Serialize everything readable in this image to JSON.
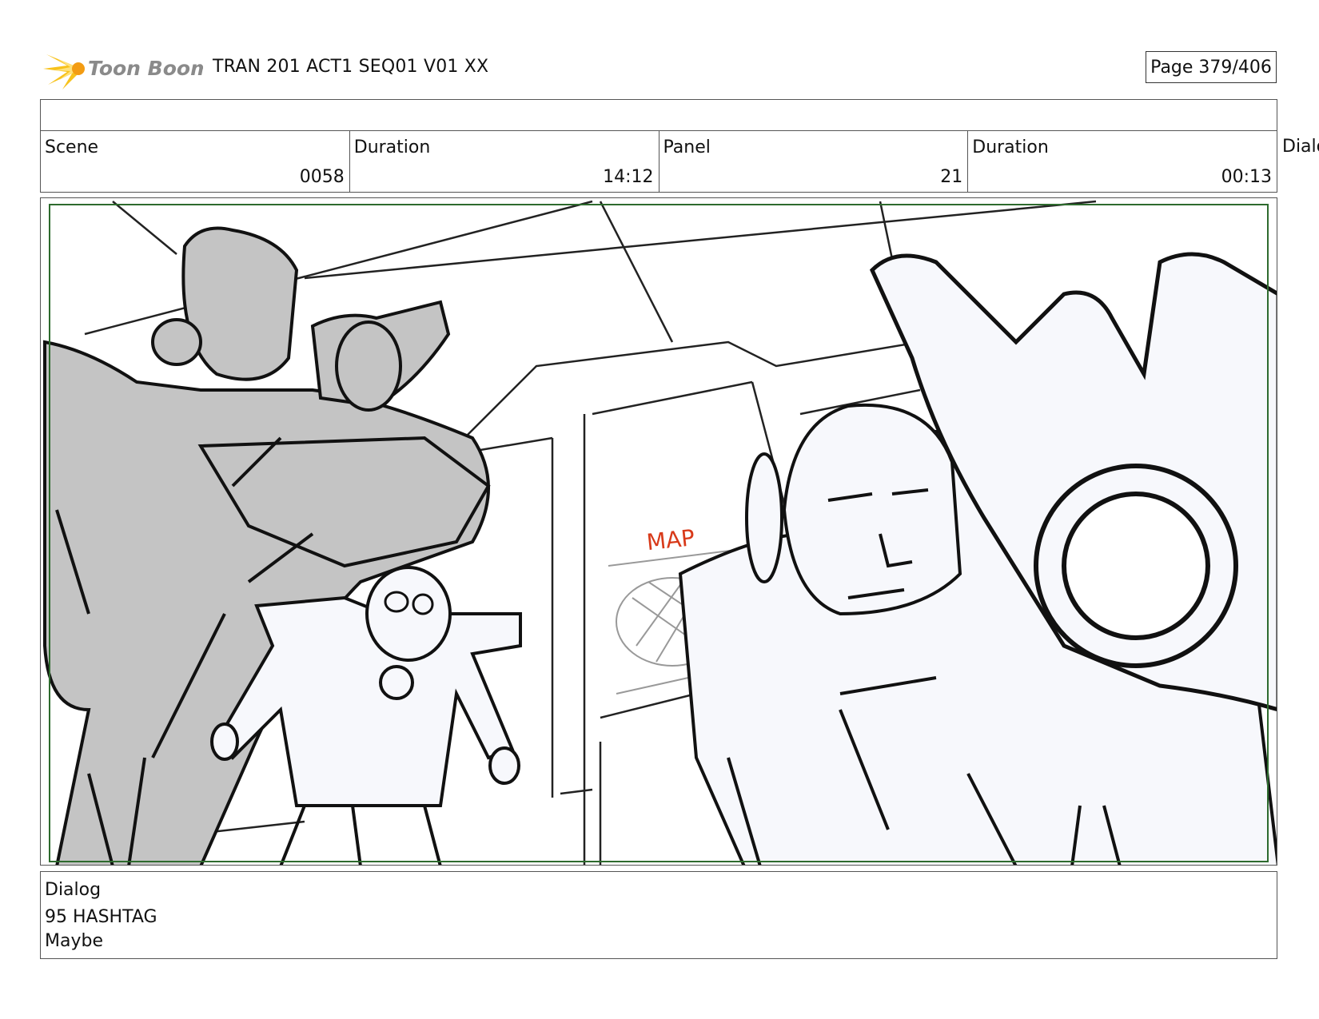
{
  "header": {
    "logo_text": "Toon Boom",
    "title": "TRAN 201 ACT1 SEQ01 V01 XX",
    "page": "Page 379/406"
  },
  "info": {
    "scene_label": "Scene",
    "scene_value": "0058",
    "duration_label": "Duration",
    "duration_value": "14:12",
    "panel_label": "Panel",
    "panel_value": "21",
    "panel_duration_label": "Duration",
    "panel_duration_value": "00:13",
    "overflow_label": "Dialo"
  },
  "panel": {
    "annotation": "MAP",
    "frame_color": "#2e6b2e",
    "annotation_color": "#d83a1a"
  },
  "dialog": {
    "label": "Dialog",
    "line1": "95 HASHTAG",
    "line2": "Maybe"
  }
}
